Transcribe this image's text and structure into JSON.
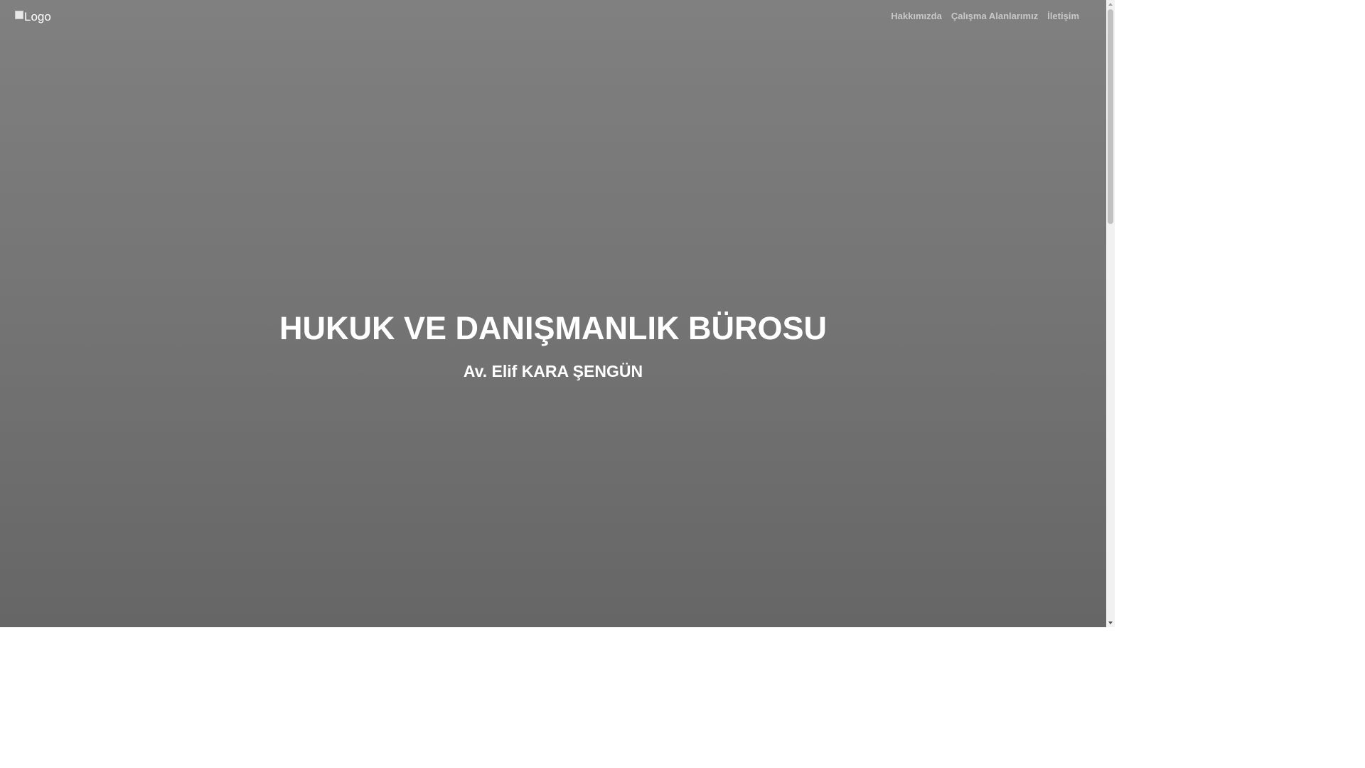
{
  "header": {
    "logo_alt": "Logo",
    "nav": [
      {
        "label": "Hakkımızda"
      },
      {
        "label": "Çalışma Alanlarımız"
      },
      {
        "label": "İletişim"
      }
    ]
  },
  "hero": {
    "title": "HUKUK VE DANIŞMANLIK BÜROSU",
    "subtitle": "Av. Elif KARA ŞENGÜN"
  },
  "icons": {
    "logo": "broken-image-icon",
    "scroll_up": "chevron-up-icon",
    "scroll_down": "chevron-down-icon"
  },
  "colors": {
    "hero_top": "#808080",
    "hero_bottom": "#666666",
    "nav_text": "#c9c9c9",
    "hero_text": "#ffffff"
  }
}
